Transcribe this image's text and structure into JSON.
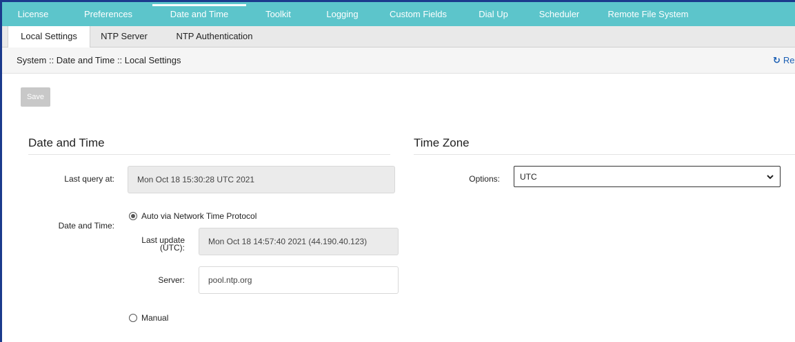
{
  "topnav": {
    "tabs": [
      {
        "label": "License"
      },
      {
        "label": "Preferences"
      },
      {
        "label": "Date and Time",
        "active": true
      },
      {
        "label": "Toolkit"
      },
      {
        "label": "Logging"
      },
      {
        "label": "Custom Fields"
      },
      {
        "label": "Dial Up"
      },
      {
        "label": "Scheduler"
      },
      {
        "label": "Remote File System"
      }
    ]
  },
  "subnav": {
    "tabs": [
      {
        "label": "Local Settings",
        "active": true
      },
      {
        "label": "NTP Server"
      },
      {
        "label": "NTP Authentication"
      }
    ]
  },
  "breadcrumb": "System :: Date and Time :: Local Settings",
  "refresh": {
    "label": "Re",
    "icon": "refresh-icon"
  },
  "save_label": "Save",
  "date_time": {
    "title": "Date and Time",
    "last_query_label": "Last query at:",
    "last_query_value": "Mon Oct 18 15:30:28 UTC 2021",
    "date_time_label": "Date and Time:",
    "auto_label": "Auto via Network Time Protocol",
    "last_update_label_1": "Last update",
    "last_update_label_2": "(UTC):",
    "last_update_value": "Mon Oct 18 14:57:40 2021 (44.190.40.123)",
    "server_label": "Server:",
    "server_value": "pool.ntp.org",
    "manual_label": "Manual",
    "selected": "auto"
  },
  "time_zone": {
    "title": "Time Zone",
    "options_label": "Options:",
    "options_value": "UTC"
  },
  "colors": {
    "nav_bg": "#5cc5cb",
    "frame": "#1b3a8c",
    "link": "#1b5fb4"
  }
}
